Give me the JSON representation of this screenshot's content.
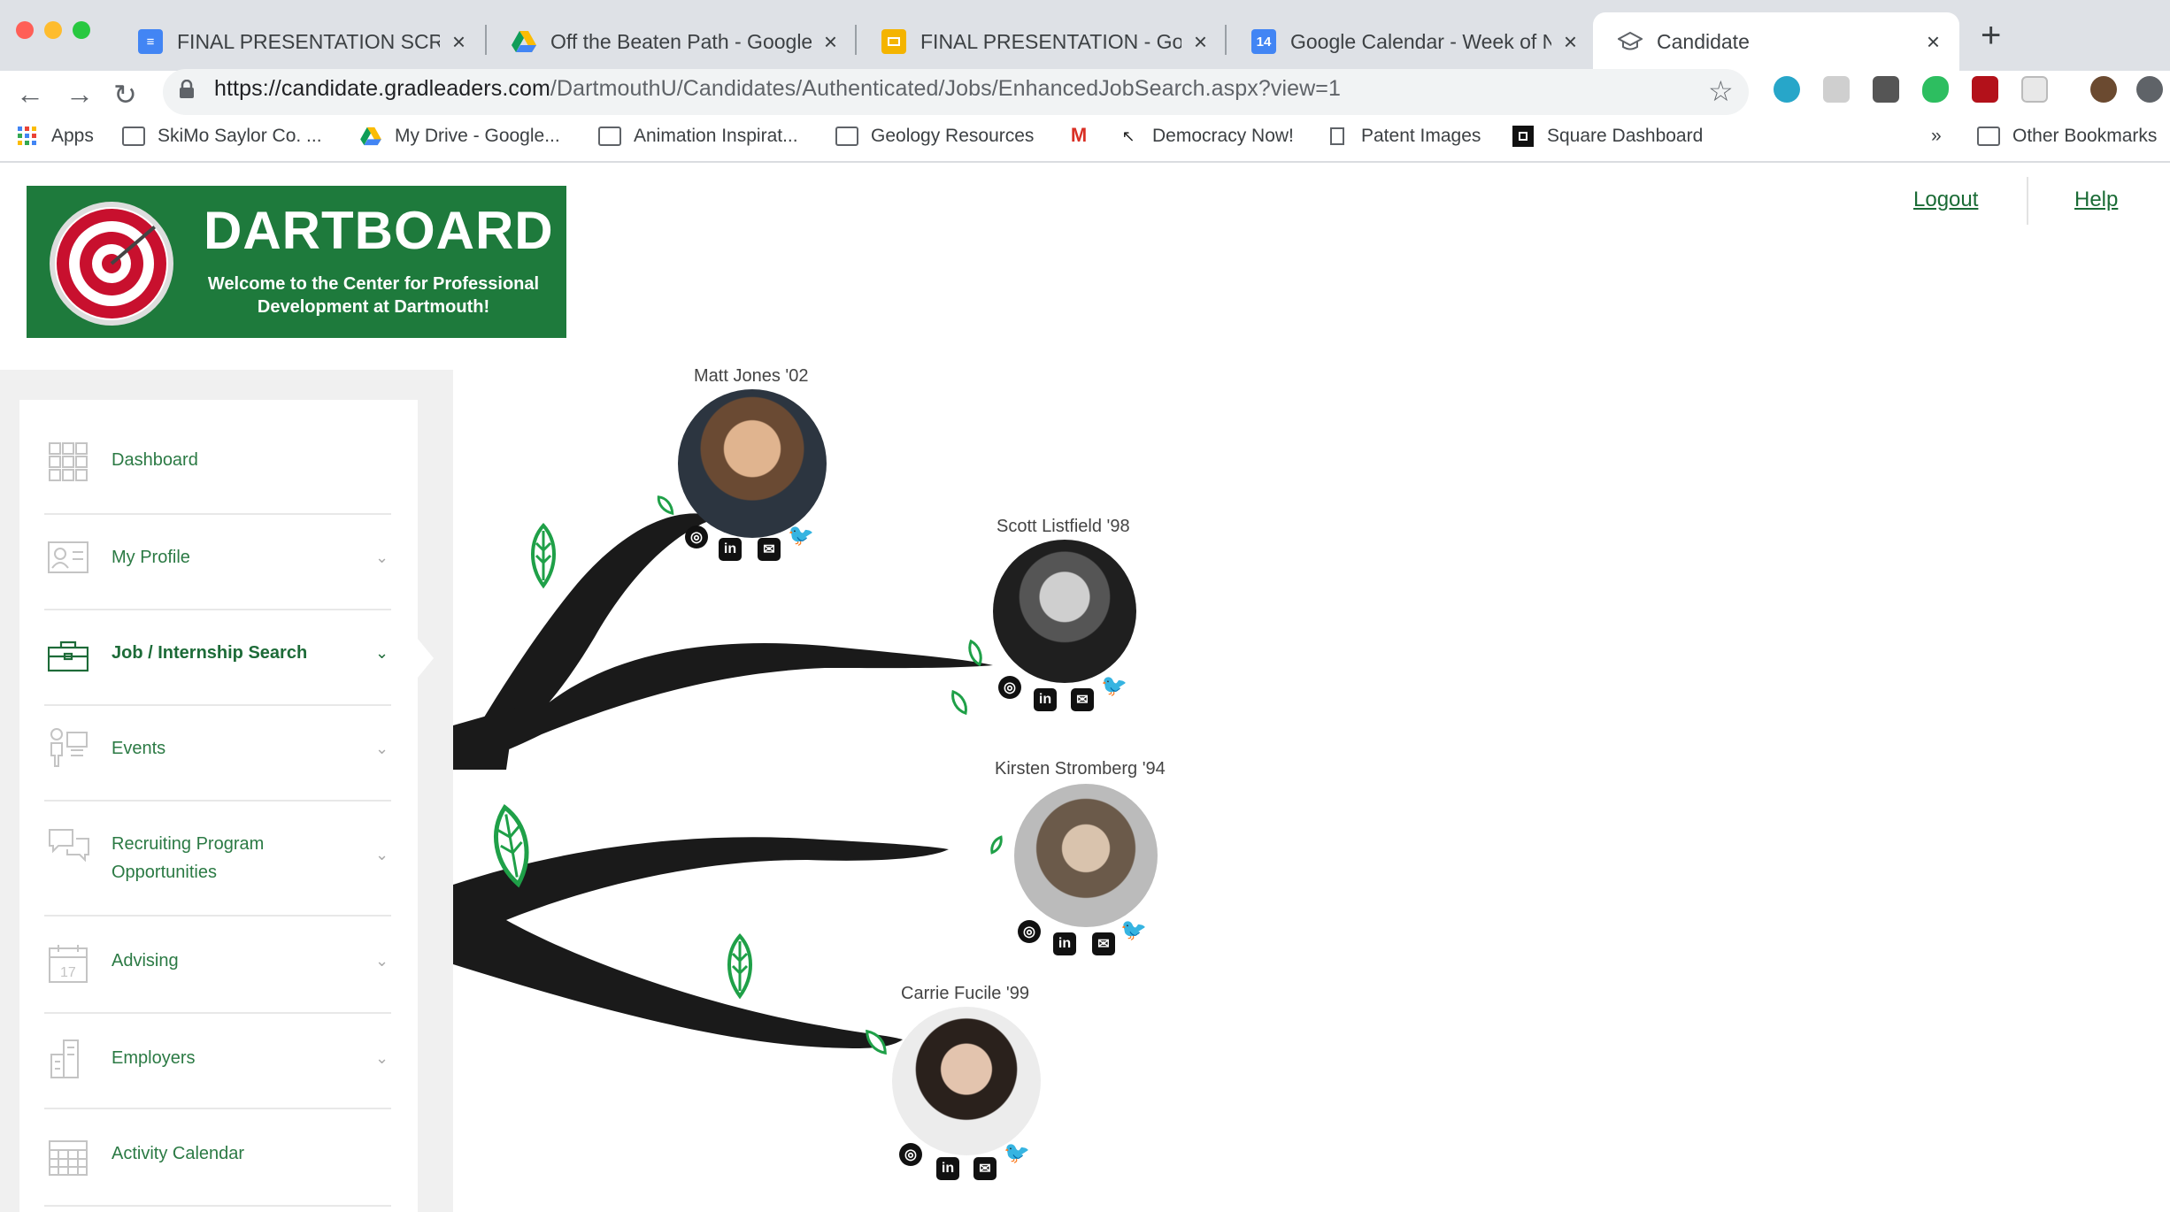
{
  "browser": {
    "tabs": [
      {
        "title": "FINAL PRESENTATION SCRIPT",
        "icon": "docs-icon",
        "color": "#4285f4"
      },
      {
        "title": "Off the Beaten Path - Google D",
        "icon": "drive-icon",
        "color": "#0f9d58"
      },
      {
        "title": "FINAL PRESENTATION - Googl",
        "icon": "slides-icon",
        "color": "#f4b400"
      },
      {
        "title": "Google Calendar - Week of No",
        "icon": "calendar-icon",
        "color": "#4285f4",
        "badge": "14"
      },
      {
        "title": "Candidate",
        "icon": "graduation-cap-icon",
        "color": "#5f6368",
        "active": true
      }
    ],
    "url_domain": "https://candidate.gradleaders.com",
    "url_path": "/DartmouthU/Candidates/Authenticated/Jobs/EnhancedJobSearch.aspx?view=1",
    "bookmarks": [
      {
        "label": "Apps",
        "icon": "apps-grid-icon"
      },
      {
        "label": "SkiMo Saylor Co. ...",
        "icon": "folder-icon"
      },
      {
        "label": "My Drive - Google...",
        "icon": "drive-icon"
      },
      {
        "label": "Animation Inspirat...",
        "icon": "folder-icon"
      },
      {
        "label": "Geology Resources",
        "icon": "folder-icon"
      },
      {
        "label": "",
        "icon": "gmail-icon"
      },
      {
        "label": "Democracy Now!",
        "icon": "cursor-icon"
      },
      {
        "label": "Patent Images",
        "icon": "page-icon"
      },
      {
        "label": "Square Dashboard",
        "icon": "square-icon"
      }
    ],
    "overflow_label": "»",
    "other_bookmarks": "Other Bookmarks"
  },
  "header": {
    "brand_title": "DARTBOARD",
    "brand_subtitle_line1": "Welcome to the Center for Professional",
    "brand_subtitle_line2": "Development at Dartmouth!",
    "logout_label": "Logout",
    "help_label": "Help"
  },
  "sidebar": {
    "items": [
      {
        "label": "Dashboard",
        "icon": "dashboard-grid-icon",
        "chevron": false
      },
      {
        "label": "My Profile",
        "icon": "profile-card-icon",
        "chevron": true
      },
      {
        "label": "Job / Internship Search",
        "icon": "briefcase-icon",
        "chevron": true,
        "active": true
      },
      {
        "label": "Events",
        "icon": "events-icon",
        "chevron": true
      },
      {
        "label": "Recruiting Program\nOpportunities",
        "icon": "chat-bubbles-icon",
        "chevron": true
      },
      {
        "label": "Advising",
        "icon": "calendar-17-icon",
        "chevron": true
      },
      {
        "label": "Employers",
        "icon": "building-icon",
        "chevron": true
      },
      {
        "label": "Activity Calendar",
        "icon": "calendar-grid-icon",
        "chevron": false
      }
    ]
  },
  "alumni": [
    {
      "name": "Matt Jones '02",
      "socials": [
        "instagram",
        "linkedin",
        "email",
        "twitter"
      ]
    },
    {
      "name": "Scott Listfield '98",
      "socials": [
        "instagram",
        "linkedin",
        "email",
        "twitter"
      ]
    },
    {
      "name": "Kirsten Stromberg '94",
      "socials": [
        "instagram",
        "linkedin",
        "email",
        "twitter"
      ]
    },
    {
      "name": "Carrie Fucile '99",
      "socials": [
        "instagram",
        "linkedin",
        "email",
        "twitter"
      ]
    }
  ],
  "colors": {
    "brand_green": "#1e7a3c",
    "link_green": "#1a6b35",
    "nav_green": "#2b7a44",
    "leaf_green": "#1fa048",
    "branch": "#1a1a1a",
    "target_red": "#c8102e"
  }
}
